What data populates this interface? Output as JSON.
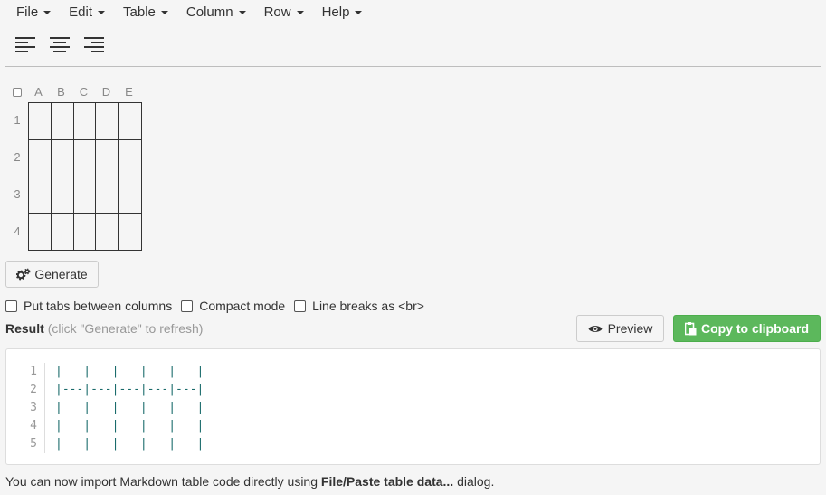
{
  "menu": [
    {
      "label": "File",
      "name": "menu-file"
    },
    {
      "label": "Edit",
      "name": "menu-edit"
    },
    {
      "label": "Table",
      "name": "menu-table"
    },
    {
      "label": "Column",
      "name": "menu-column"
    },
    {
      "label": "Row",
      "name": "menu-row"
    },
    {
      "label": "Help",
      "name": "menu-help"
    }
  ],
  "toolbar": {
    "icons": [
      "align-left-icon",
      "align-center-icon",
      "align-right-icon"
    ]
  },
  "grid": {
    "columns": [
      "A",
      "B",
      "C",
      "D",
      "E"
    ],
    "rows": [
      "1",
      "2",
      "3",
      "4"
    ]
  },
  "generate_label": "Generate",
  "options": [
    {
      "label": "Put tabs between columns",
      "name": "tabs-between-columns-checkbox"
    },
    {
      "label": "Compact mode",
      "name": "compact-mode-checkbox"
    },
    {
      "label": "Line breaks as <br>",
      "name": "line-breaks-checkbox"
    }
  ],
  "result": {
    "label": "Result",
    "hint": "(click \"Generate\" to refresh)"
  },
  "preview_label": "Preview",
  "copy_label": "Copy to clipboard",
  "code": {
    "line_numbers": [
      "1",
      "2",
      "3",
      "4",
      "5"
    ],
    "lines": [
      "|   |   |   |   |   |",
      "|---|---|---|---|---|",
      "|   |   |   |   |   |",
      "|   |   |   |   |   |",
      "|   |   |   |   |   |"
    ]
  },
  "footer": {
    "prefix": "You can now import Markdown table code directly using ",
    "bold": "File/Paste table data...",
    "suffix": " dialog."
  }
}
